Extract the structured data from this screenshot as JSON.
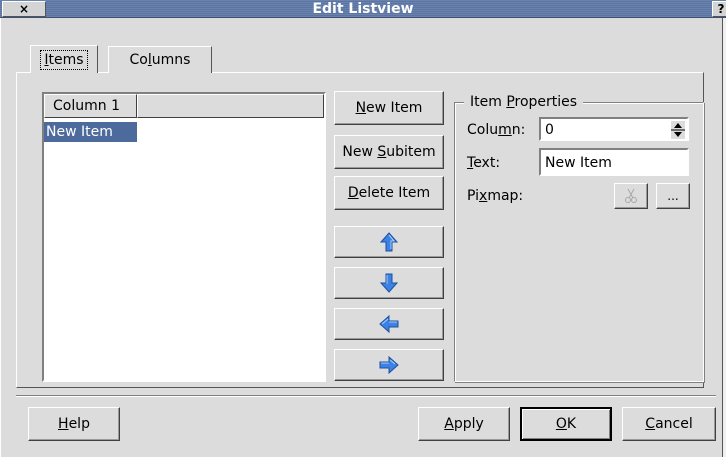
{
  "window": {
    "title": "Edit Listview",
    "close_glyph": "×",
    "help_glyph": "?"
  },
  "tabs": [
    {
      "label_pre": "",
      "label_u": "I",
      "label_post": "tems",
      "active": true
    },
    {
      "label_pre": "Co",
      "label_u": "l",
      "label_post": "umns",
      "active": false
    }
  ],
  "listview": {
    "columns": [
      "Column 1"
    ],
    "items": [
      "New Item"
    ],
    "selected_index": 0
  },
  "item_buttons": {
    "new_item": {
      "pre": "",
      "u": "N",
      "post": "ew Item"
    },
    "new_subitem": {
      "pre": "New ",
      "u": "S",
      "post": "ubitem"
    },
    "delete_item": {
      "pre": "",
      "u": "D",
      "post": "elete Item"
    },
    "move_icons": [
      "arrow-up-icon",
      "arrow-down-icon",
      "arrow-left-icon",
      "arrow-right-icon"
    ]
  },
  "properties": {
    "title_pre": "Item ",
    "title_u": "P",
    "title_post": "roperties",
    "column_label": {
      "pre": "Colu",
      "u": "m",
      "post": "n:"
    },
    "column_value": "0",
    "text_label": {
      "pre": "",
      "u": "T",
      "post": "ext:"
    },
    "text_value": "New Item",
    "pixmap_label": {
      "pre": "Pi",
      "u": "x",
      "post": "map:"
    },
    "cut_icon": "scissors-icon",
    "browse_label": "..."
  },
  "dialog_buttons": {
    "help": {
      "pre": "",
      "u": "H",
      "post": "elp"
    },
    "apply": {
      "pre": "",
      "u": "A",
      "post": "pply"
    },
    "ok": {
      "pre": "",
      "u": "O",
      "post": "K"
    },
    "cancel": {
      "pre": "",
      "u": "C",
      "post": "ancel"
    }
  },
  "colors": {
    "titlebar": "#5a74a4",
    "selection": "#4d6a9c",
    "arrow": "#3c82e6",
    "face": "#dcdcdc"
  }
}
